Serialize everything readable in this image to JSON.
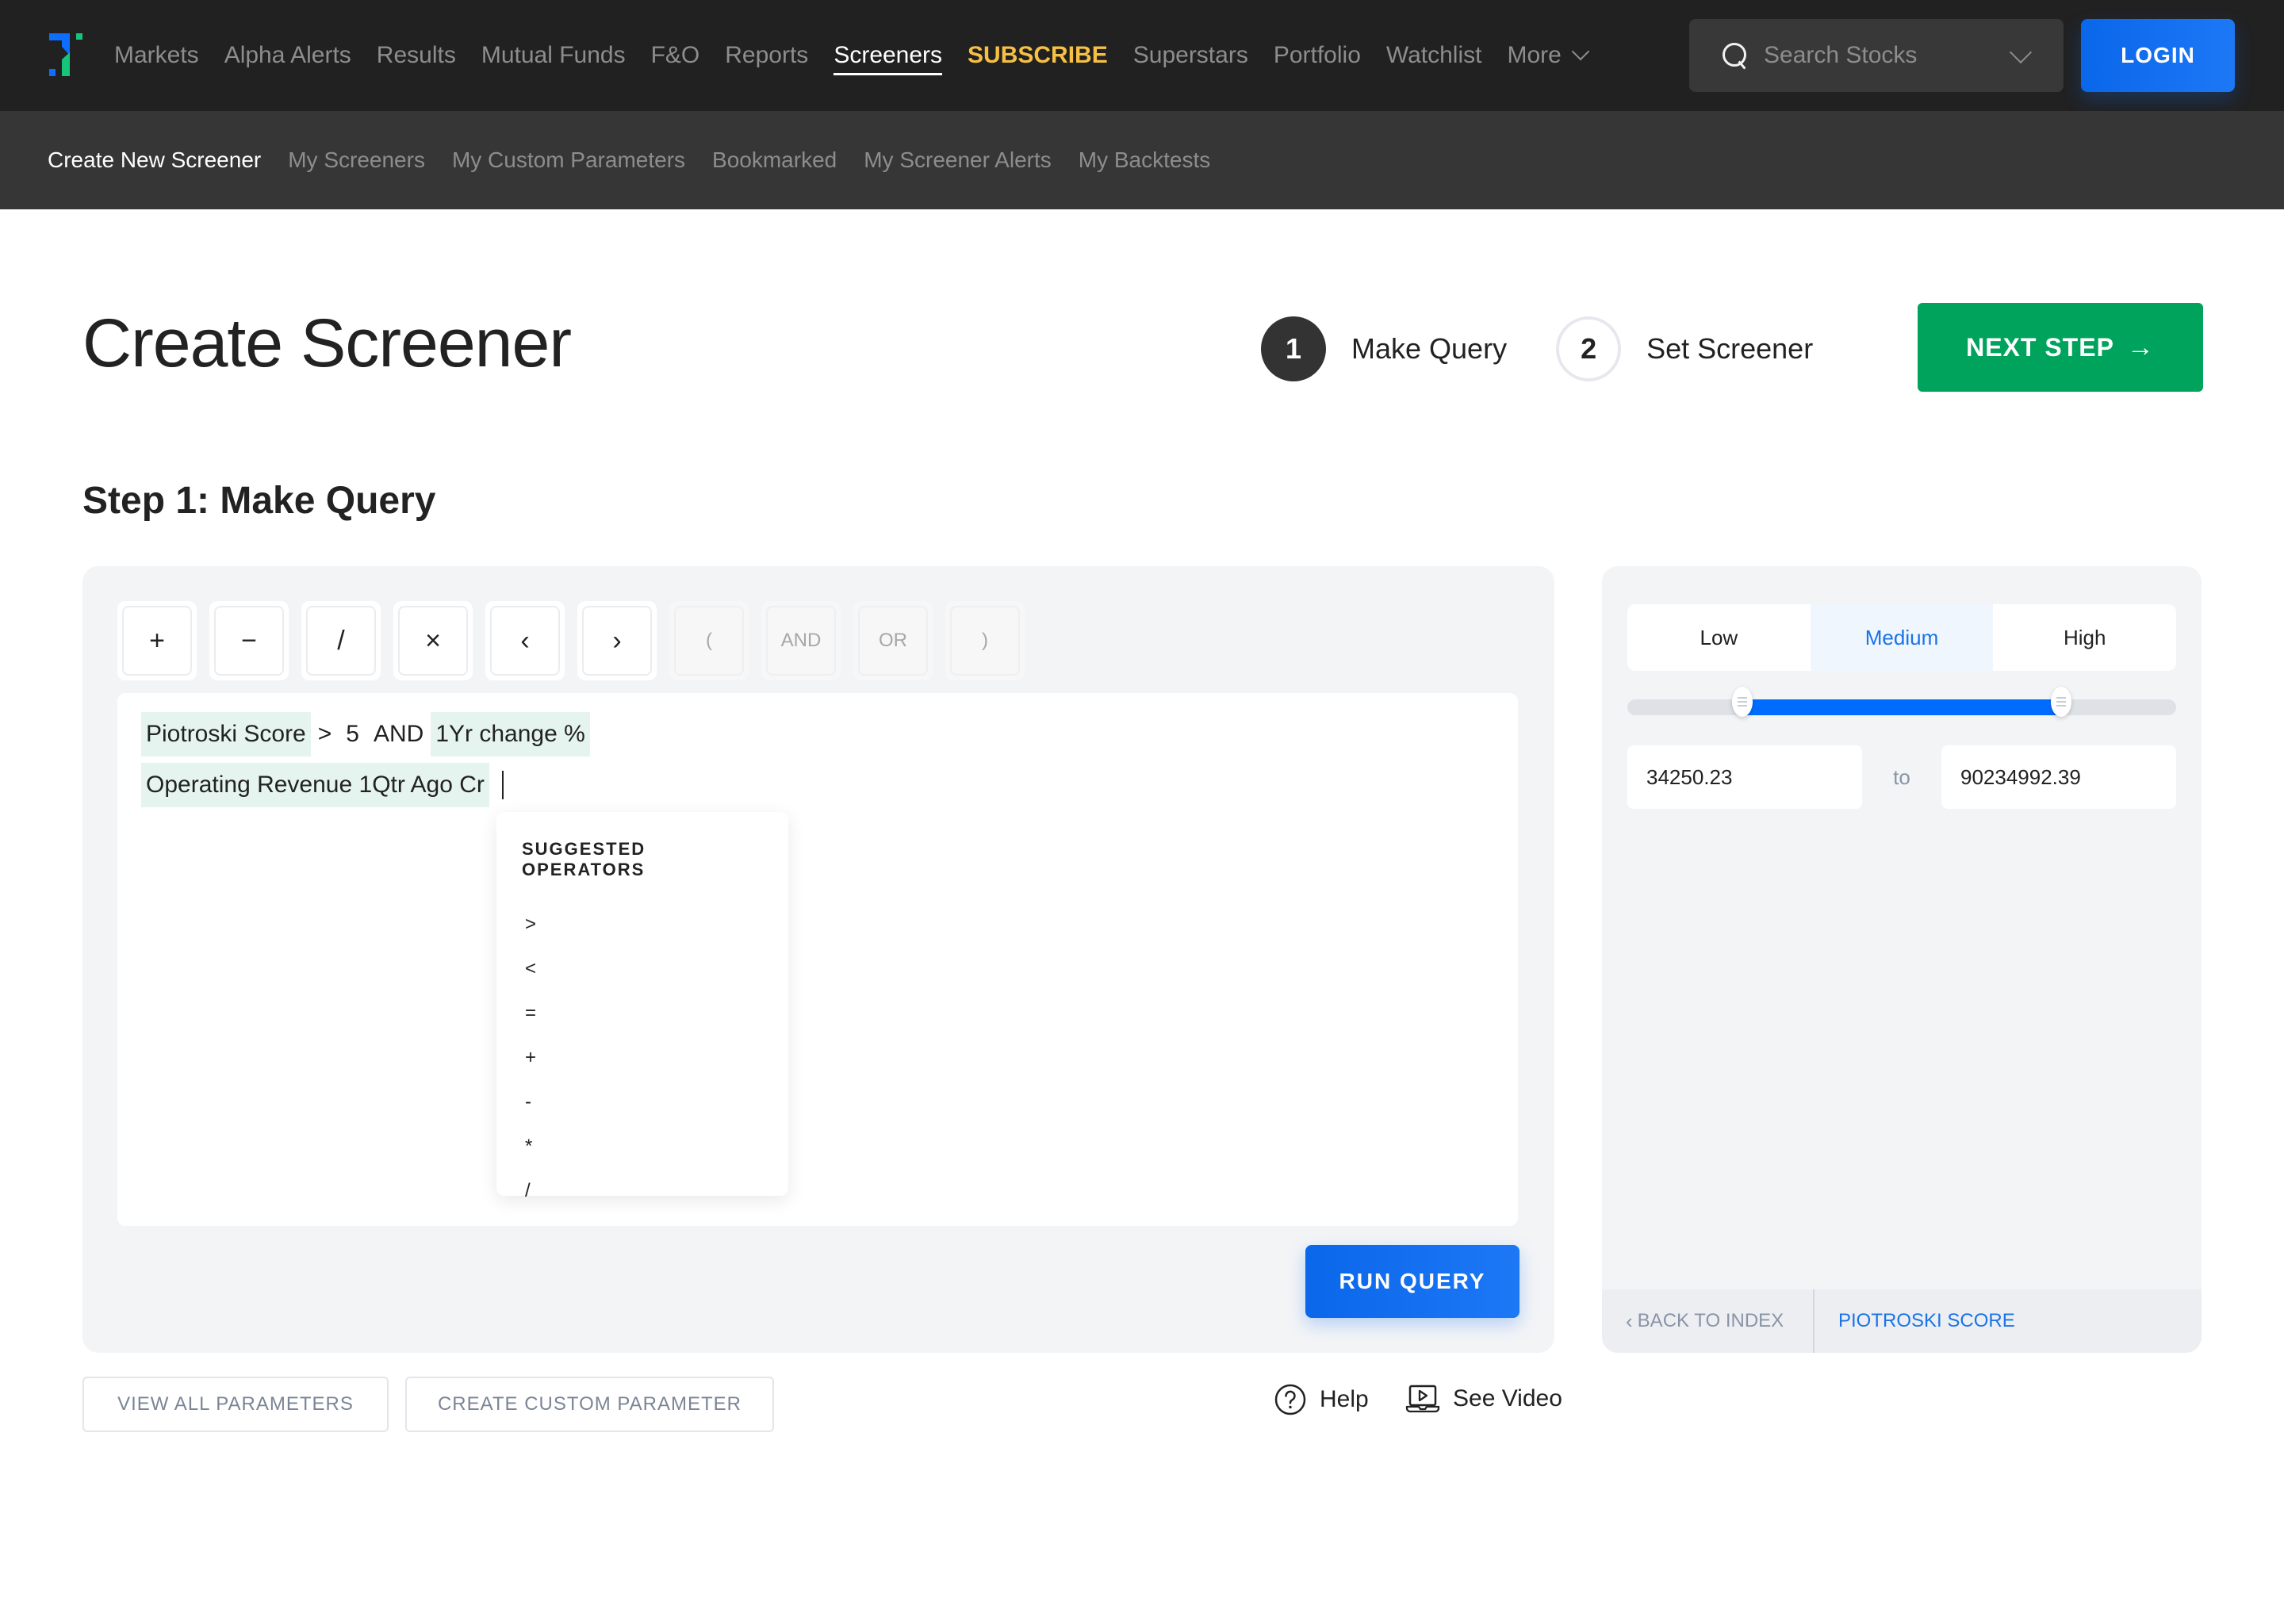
{
  "topnav": {
    "logo": "logo-icon",
    "links": [
      {
        "label": "Markets",
        "state": "normal"
      },
      {
        "label": "Alpha Alerts",
        "state": "normal"
      },
      {
        "label": "Results",
        "state": "normal"
      },
      {
        "label": "Mutual Funds",
        "state": "normal"
      },
      {
        "label": "F&O",
        "state": "normal"
      },
      {
        "label": "Reports",
        "state": "normal"
      },
      {
        "label": "Screeners",
        "state": "active"
      },
      {
        "label": "SUBSCRIBE",
        "state": "highlight"
      },
      {
        "label": "Superstars",
        "state": "normal"
      },
      {
        "label": "Portfolio",
        "state": "normal"
      },
      {
        "label": "Watchlist",
        "state": "normal"
      },
      {
        "label": "More",
        "state": "dropdown"
      }
    ],
    "search_placeholder": "Search Stocks",
    "login_label": "LOGIN",
    "colors": {
      "background": "#212121",
      "subscribe": "#f6c043",
      "login": "#1470f0"
    }
  },
  "subnav": {
    "links": [
      {
        "label": "Create New Screener",
        "active": true
      },
      {
        "label": "My Screeners",
        "active": false
      },
      {
        "label": "My Custom Parameters",
        "active": false
      },
      {
        "label": "Bookmarked",
        "active": false
      },
      {
        "label": "My Screener Alerts",
        "active": false
      },
      {
        "label": "My Backtests",
        "active": false
      }
    ]
  },
  "header": {
    "title": "Create Screener",
    "steps": [
      {
        "number": "1",
        "label": "Make Query",
        "state": "current"
      },
      {
        "number": "2",
        "label": "Set Screener",
        "state": "upcoming"
      }
    ],
    "next_label": "NEXT STEP",
    "next_arrow": "→",
    "next_color": "#00a35c"
  },
  "section_title": "Step 1: Make Query",
  "query_panel": {
    "operators": [
      {
        "symbol": "+",
        "name": "plus",
        "enabled": true
      },
      {
        "symbol": "−",
        "name": "minus",
        "enabled": true
      },
      {
        "symbol": "/",
        "name": "divide",
        "enabled": true
      },
      {
        "symbol": "×",
        "name": "multiply",
        "enabled": true
      },
      {
        "symbol": "‹",
        "name": "less-than",
        "enabled": true
      },
      {
        "symbol": "›",
        "name": "greater-than",
        "enabled": true
      },
      {
        "symbol": "(",
        "name": "open-paren",
        "enabled": false
      },
      {
        "symbol": "AND",
        "name": "and",
        "enabled": false
      },
      {
        "symbol": "OR",
        "name": "or",
        "enabled": false
      },
      {
        "symbol": ")",
        "name": "close-paren",
        "enabled": false
      }
    ],
    "query_lines": [
      [
        {
          "text": "Piotroski Score",
          "type": "param"
        },
        {
          "text": ">",
          "type": "op"
        },
        {
          "text": "5",
          "type": "value"
        },
        {
          "text": "AND",
          "type": "op"
        },
        {
          "text": "1Yr change %",
          "type": "param"
        }
      ],
      [
        {
          "text": "Operating Revenue 1Qtr Ago Cr",
          "type": "param"
        }
      ]
    ],
    "suggestions": {
      "title": "SUGGESTED OPERATORS",
      "items": [
        ">",
        "<",
        "=",
        "+",
        "-",
        "*",
        "/"
      ]
    },
    "run_label": "RUN QUERY"
  },
  "param_panel": {
    "levels": [
      {
        "label": "Low",
        "active": false
      },
      {
        "label": "Medium",
        "active": true
      },
      {
        "label": "High",
        "active": false
      }
    ],
    "slider": {
      "lower_fraction": 0.21,
      "upper_fraction": 0.79,
      "fill_color": "#006cff"
    },
    "range_min": "34250.23",
    "range_to": "to",
    "range_max": "90234992.39",
    "back_label": "BACK TO INDEX",
    "current_param": "PIOTROSKI SCORE"
  },
  "actions": {
    "view_all": "VIEW ALL PARAMETERS",
    "create_custom": "CREATE CUSTOM PARAMETER",
    "help": "Help",
    "see_video": "See Video"
  }
}
